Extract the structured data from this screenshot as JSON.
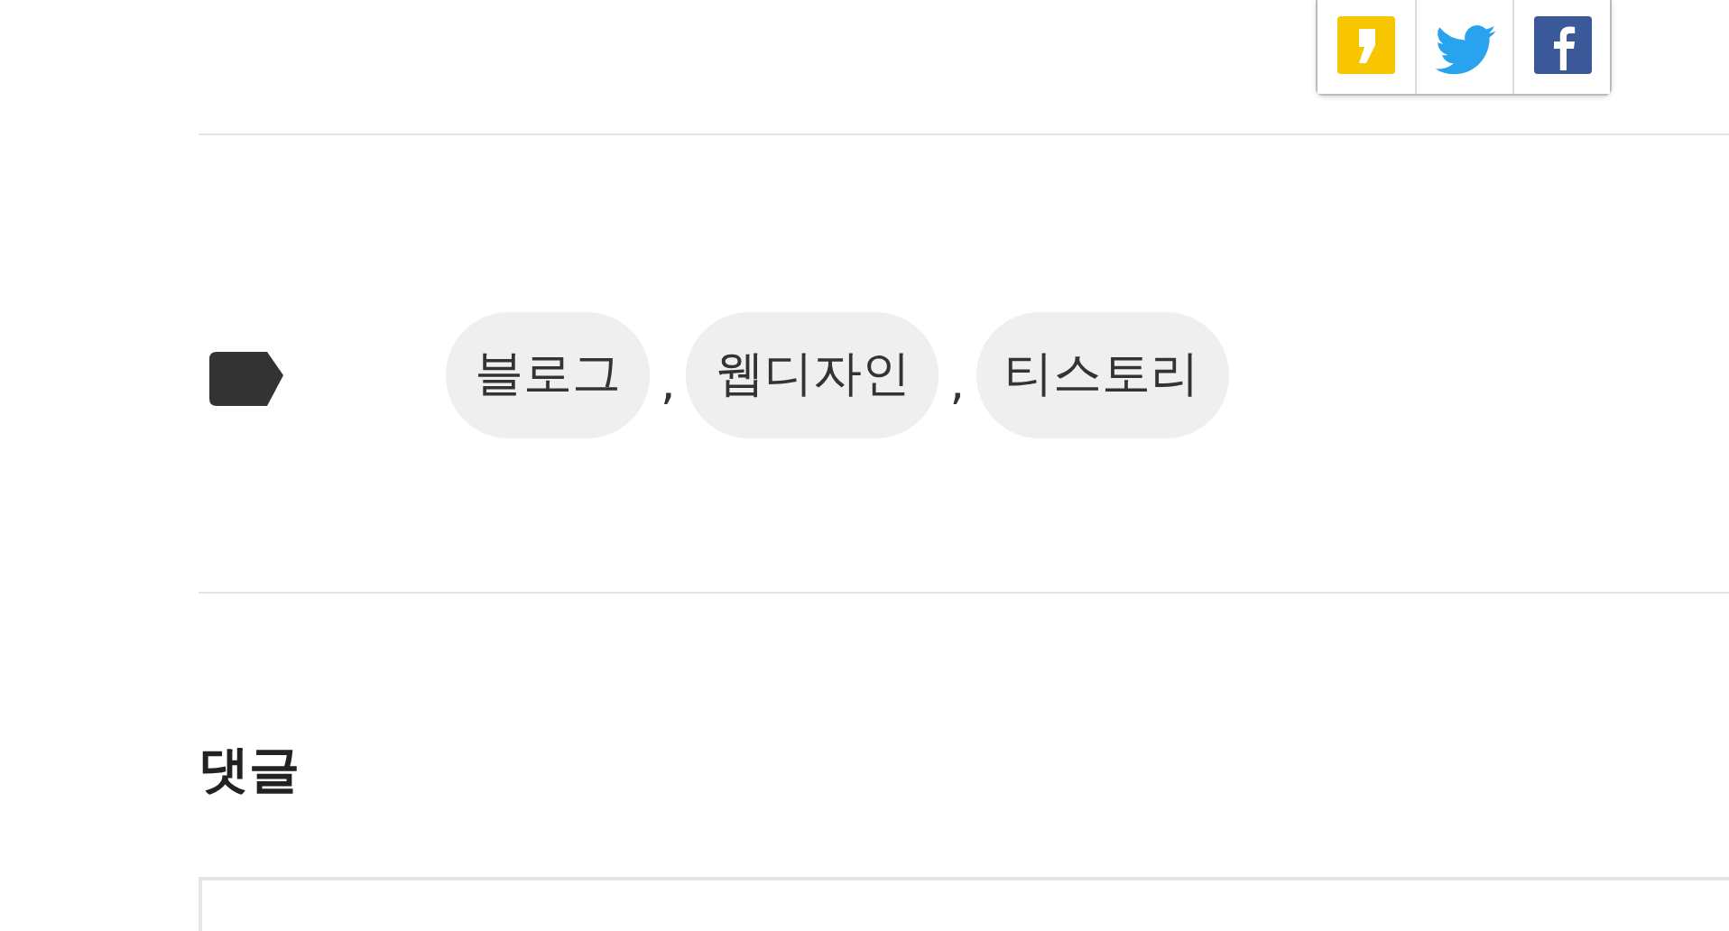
{
  "share": [
    {
      "kind": "kakaostory"
    },
    {
      "kind": "twitter"
    },
    {
      "kind": "facebook"
    }
  ],
  "tags": [
    {
      "label": "블로그",
      "separator": ","
    },
    {
      "label": "웹디자인",
      "separator": ","
    },
    {
      "label": "티스토리"
    }
  ],
  "comments": {
    "title": "댓글"
  }
}
